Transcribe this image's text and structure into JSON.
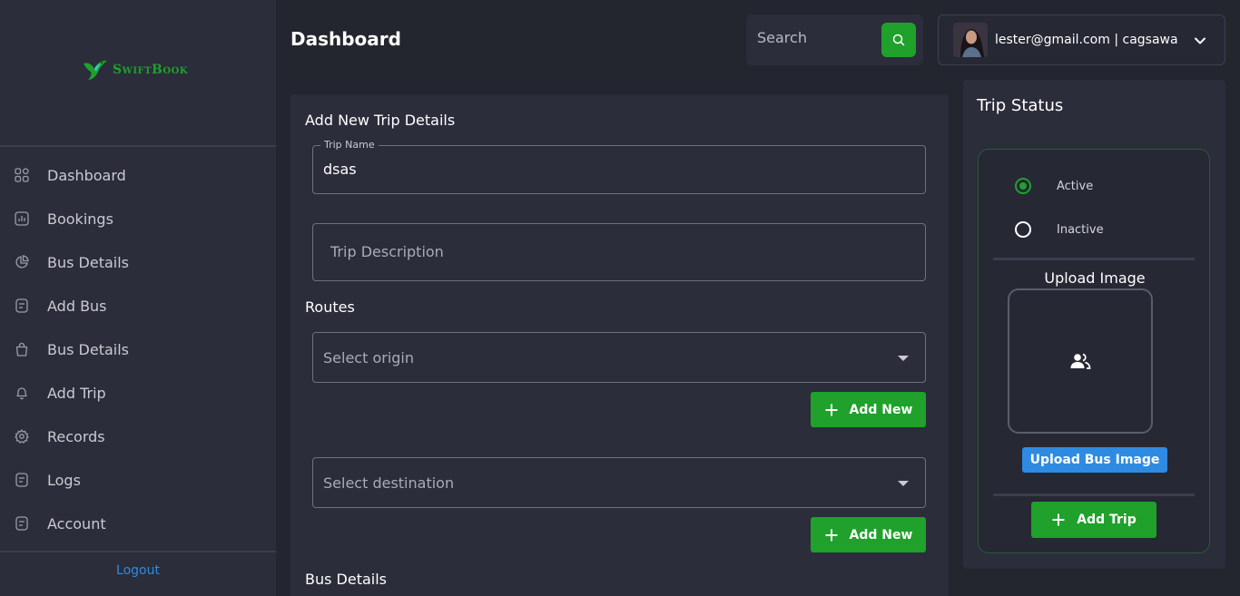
{
  "app": {
    "brand": "SwiftBook"
  },
  "sidebar": {
    "items": [
      {
        "label": "Dashboard",
        "icon": "grid-icon"
      },
      {
        "label": "Bookings",
        "icon": "chart-icon"
      },
      {
        "label": "Bus Details",
        "icon": "pie-chart-icon"
      },
      {
        "label": "Add Bus",
        "icon": "document-icon"
      },
      {
        "label": "Bus Details",
        "icon": "bag-icon"
      },
      {
        "label": "Add Trip",
        "icon": "bell-icon"
      },
      {
        "label": "Records",
        "icon": "gear-icon"
      },
      {
        "label": "Logs",
        "icon": "document-icon"
      },
      {
        "label": "Account",
        "icon": "document-icon"
      }
    ],
    "logout_label": "Logout"
  },
  "header": {
    "title": "Dashboard",
    "search_placeholder": "Search",
    "user_label": "lester@gmail.com | cagsawa"
  },
  "form": {
    "title": "Add New Trip Details",
    "trip_name_label": "Trip Name",
    "trip_name_value": "dsas",
    "trip_description_placeholder": "Trip Description",
    "routes_title": "Routes",
    "origin_placeholder": "Select origin",
    "destination_placeholder": "Select destination",
    "add_new_label": "Add New",
    "bus_details_title": "Bus Details"
  },
  "status_panel": {
    "title": "Trip Status",
    "options": [
      "Active",
      "Inactive"
    ],
    "selected": "Active",
    "upload_title": "Upload Image",
    "upload_button_label": "Upload Bus Image",
    "add_trip_label": "Add Trip"
  },
  "colors": {
    "accent_green": "#1fa12b",
    "accent_blue": "#2f8be2",
    "background": "#23252f",
    "panel": "#2b2d3b"
  }
}
